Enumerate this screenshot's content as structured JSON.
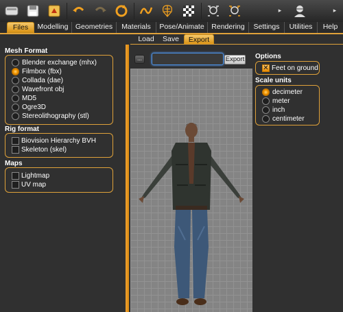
{
  "tabs": [
    "Files",
    "Modelling",
    "Geometries",
    "Materials",
    "Pose/Animate",
    "Rendering",
    "Settings",
    "Utilities",
    "Help"
  ],
  "subtabs": [
    "Load",
    "Save",
    "Export"
  ],
  "left": {
    "mesh_title": "Mesh Format",
    "mesh_options": [
      "Blender exchange (mhx)",
      "Filmbox (fbx)",
      "Collada (dae)",
      "Wavefront obj",
      "MD5",
      "Ogre3D",
      "Stereolithography (stl)"
    ],
    "mesh_selected": 1,
    "rig_title": "Rig format",
    "rig_options": [
      "Biovision Hierarchy BVH",
      "Skeleton (skel)"
    ],
    "maps_title": "Maps",
    "maps_options": [
      "Lightmap",
      "UV map"
    ]
  },
  "export_bar": {
    "dots_label": "...",
    "filename_value": "",
    "export_label": "Export"
  },
  "right": {
    "options_title": "Options",
    "feet_label": "Feet on ground",
    "feet_checked": true,
    "scale_title": "Scale units",
    "scale_options": [
      "decimeter",
      "meter",
      "inch",
      "centimeter"
    ],
    "scale_selected": 0
  },
  "icons": [
    "files-icon",
    "save-icon",
    "export-icon",
    "undo-icon",
    "redo-icon",
    "reset-icon",
    "smooth-icon",
    "wireframe-icon",
    "background-icon",
    "front-view-icon",
    "back-view-icon",
    "more-icon",
    "profile-icon"
  ]
}
